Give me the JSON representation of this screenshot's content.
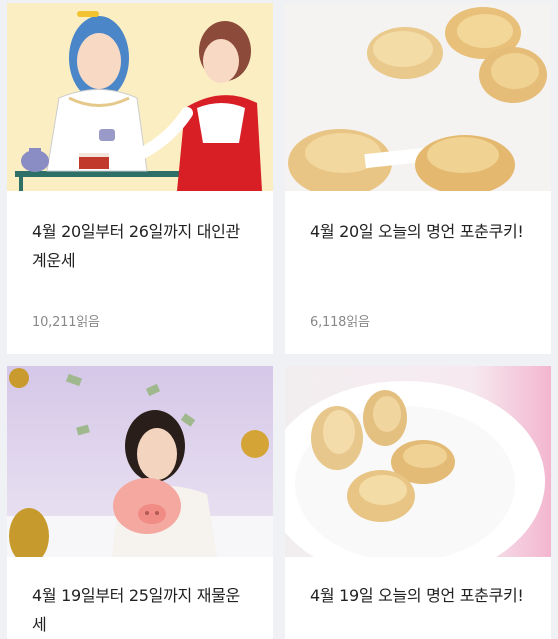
{
  "articles": [
    {
      "title": "4월 20일부터 26일까지 대인관계운세",
      "reads": "10,211읽음",
      "image": "two-women-tea-illustration"
    },
    {
      "title": "4월 20일 오늘의 명언 포춘쿠키!",
      "reads": "6,118읽음",
      "image": "fortune-cookies-photo"
    },
    {
      "title": "4월 19일부터 25일까지 재물운세",
      "reads": "",
      "image": "woman-piggy-bank-photo"
    },
    {
      "title": "4월 19일 오늘의 명언 포춘쿠키!",
      "reads": "",
      "image": "fortune-cookies-plate-photo"
    }
  ]
}
